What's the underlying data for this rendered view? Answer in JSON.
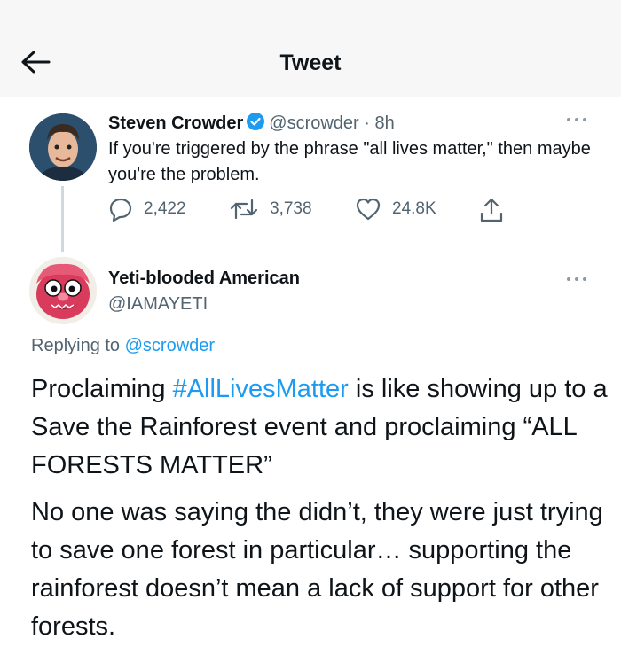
{
  "header": {
    "title": "Tweet",
    "back_icon": "arrow-left-icon"
  },
  "tweet1": {
    "author_name": "Steven Crowder",
    "handle": "@scrowder",
    "separator": " · ",
    "time": "8h",
    "text": "If you're triggered by the phrase \"all lives matter,\" then maybe you're the problem.",
    "replies": "2,422",
    "retweets": "3,738",
    "likes": "24.8K",
    "accent": "#1d9bf0"
  },
  "tweet2": {
    "author_name": "Yeti-blooded American",
    "handle": "@IAMAYETI",
    "replying_prefix": "Replying to ",
    "replying_to": "@scrowder",
    "p1_before": "Proclaiming ",
    "hashtag": "#AllLivesMatter",
    "p1_after": " is like showing up to a Save the Rainforest event and proclaiming “ALL FORESTS MATTER”",
    "p2": "No one was saying the didn’t, they were just trying to save one forest in particular… supporting the rainforest doesn’t mean a lack of support for other forests."
  }
}
